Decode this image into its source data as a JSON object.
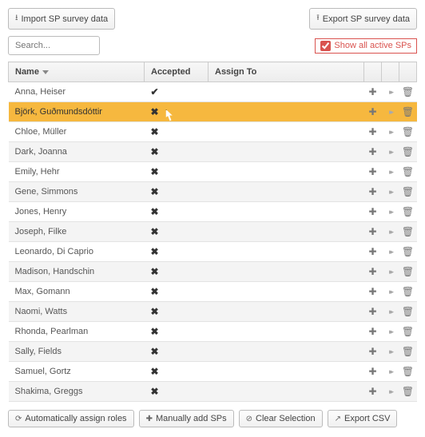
{
  "toolbar": {
    "import_label": "Import SP survey data",
    "export_label": "Export SP survey data"
  },
  "search": {
    "placeholder": "Search..."
  },
  "show_active": {
    "label": "Show all active SPs",
    "checked": true
  },
  "columns": {
    "name": "Name",
    "accepted": "Accepted",
    "assign": "Assign To"
  },
  "icons": {
    "check": "✔",
    "cross": "✖",
    "plus": "✚",
    "chevrons": "▸▸",
    "trash": "🗑",
    "import": "⭳",
    "export": "⭱",
    "refresh": "⟳",
    "clear": "⊘",
    "link": "↗"
  },
  "rows": [
    {
      "name": "Anna, Heiser",
      "accepted": true,
      "selected": false
    },
    {
      "name": "Björk, Guðmundsdóttir",
      "accepted": false,
      "selected": true,
      "cursor": true
    },
    {
      "name": "Chloe, Müller",
      "accepted": false,
      "selected": false
    },
    {
      "name": "Dark, Joanna",
      "accepted": false,
      "selected": false
    },
    {
      "name": "Emily, Hehr",
      "accepted": false,
      "selected": false
    },
    {
      "name": "Gene, Simmons",
      "accepted": false,
      "selected": false
    },
    {
      "name": "Jones, Henry",
      "accepted": false,
      "selected": false
    },
    {
      "name": "Joseph, Filke",
      "accepted": false,
      "selected": false
    },
    {
      "name": "Leonardo, Di Caprio",
      "accepted": false,
      "selected": false
    },
    {
      "name": "Madison, Handschin",
      "accepted": false,
      "selected": false
    },
    {
      "name": "Max, Gomann",
      "accepted": false,
      "selected": false
    },
    {
      "name": "Naomi, Watts",
      "accepted": false,
      "selected": false
    },
    {
      "name": "Rhonda, Pearlman",
      "accepted": false,
      "selected": false
    },
    {
      "name": "Sally, Fields",
      "accepted": false,
      "selected": false
    },
    {
      "name": "Samuel, Gortz",
      "accepted": false,
      "selected": false
    },
    {
      "name": "Shakima, Greggs",
      "accepted": false,
      "selected": false
    }
  ],
  "footer": {
    "auto_assign": "Automatically assign roles",
    "manual_add": "Manually add SPs",
    "clear_sel": "Clear Selection",
    "export_csv": "Export CSV"
  }
}
